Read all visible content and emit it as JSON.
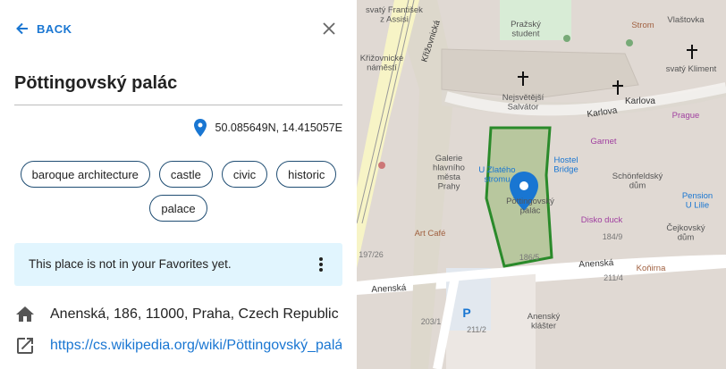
{
  "panel": {
    "back_label": "BACK",
    "title": "Pöttingovský palác",
    "coordinates": "50.085649N, 14.415057E",
    "tags": [
      "baroque architecture",
      "castle",
      "civic",
      "historic",
      "palace"
    ],
    "favorites_message": "This place is not in your Favorites yet.",
    "address": "Anenská, 186, 11000, Praha, Czech Republic",
    "link": "https://cs.wikipedia.org/wiki/Pöttingovský_palác"
  },
  "map": {
    "labels": {
      "frantisek": "svatý František\nz Assisi",
      "prazsky": "Pražský\nstudent",
      "strom": "Strom",
      "vlastovka": "Vlaštovka",
      "krizovnicke": "Křižovnické\nnáměstí",
      "krizovnicka": "Křižovnická",
      "kliment": "svatý Kliment",
      "salvator": "Nejsvětější\nSalvátor",
      "karlova1": "Karlova",
      "karlova2": "Karlova",
      "prague": "Prague",
      "garnet": "Garnet",
      "galerie": "Galerie\nhlavního\nměsta\nPrahy",
      "zlateho": "U Zlatého\nstromu",
      "hostel": "Hostel\nBridge",
      "schonfeld": "Schönfeldský\ndům",
      "pension": "Pension\nU Lilie",
      "pottingovsky": "Pöttingovský\npalác",
      "disko": "Disko duck",
      "cejkovsky": "Čejkovský\ndům",
      "artcafe": "Art Café",
      "n197": "197/26",
      "n186": "186/5",
      "n184": "184/9",
      "konirna": "Koňirna",
      "anenska1": "Anenská",
      "anenska2": "Anenská",
      "n211_4": "211/4",
      "parking": "P",
      "n203": "203/1",
      "n211_2": "211/2",
      "klaster": "Anenský\nklášter"
    }
  }
}
